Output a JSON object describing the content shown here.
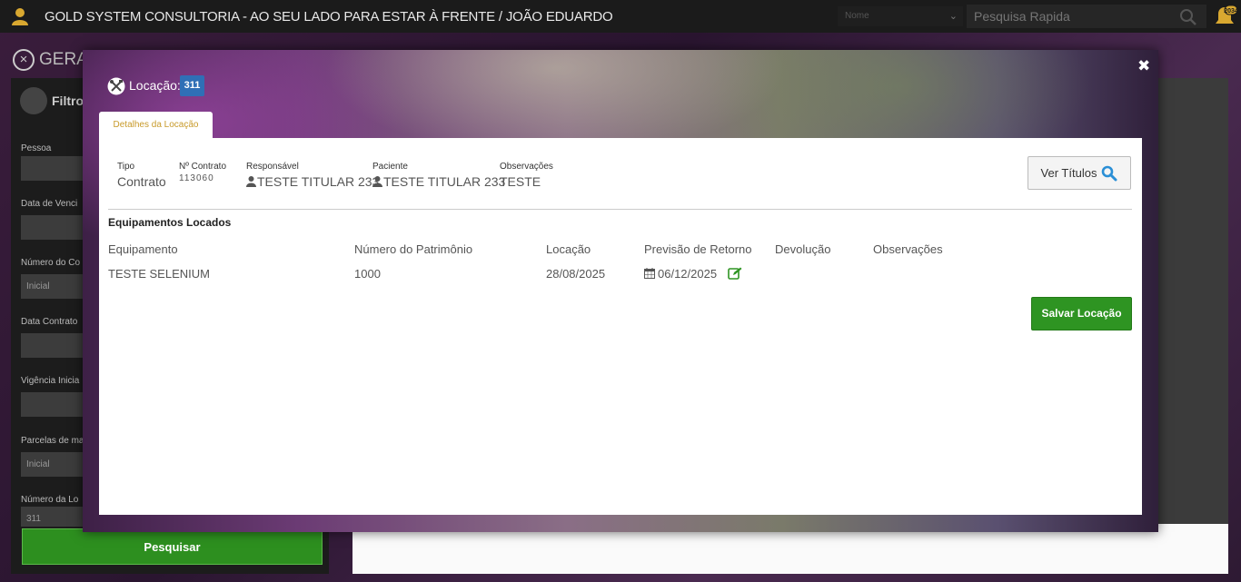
{
  "topbar": {
    "title": "GOLD SYSTEM CONSULTORIA - AO SEU LADO PARA ESTAR À FRENTE / JOÃO EDUARDO",
    "name_select": "Nome",
    "search_placeholder": "Pesquisa Rapida",
    "notification_count": "2034"
  },
  "background": {
    "page_title": "GERA",
    "filters_label": "Filtros",
    "fields": [
      {
        "label": "Pessoa",
        "value": ""
      },
      {
        "label": "Data de Venci",
        "value": ""
      },
      {
        "label": "Número do Co",
        "value": "Inicial"
      },
      {
        "label": "Data Contrato",
        "value": ""
      },
      {
        "label": "Vigência Inicia",
        "value": ""
      },
      {
        "label": "Parcelas de ma",
        "value": "Inicial"
      },
      {
        "label": "Número da Lo",
        "value": "311"
      }
    ],
    "search_button": "Pesquisar"
  },
  "modal": {
    "title_label": "Locação:",
    "location_number": "311",
    "tab_label": "Detalhes da Locação",
    "info": {
      "tipo_label": "Tipo",
      "tipo_value": "Contrato",
      "contrato_label": "Nº Contrato",
      "contrato_value": "113060",
      "responsavel_label": "Responsável",
      "responsavel_value": "TESTE TITULAR 233",
      "paciente_label": "Paciente",
      "paciente_value": "TESTE TITULAR 233",
      "observacoes_label": "Observações",
      "observacoes_value": "TESTE"
    },
    "ver_titulos_button": "Ver Títulos",
    "section_title": "Equipamentos Locados",
    "table": {
      "headers": [
        "Equipamento",
        "Número do Patrimônio",
        "Locação",
        "Previsão de Retorno",
        "Devolução",
        "Observações"
      ],
      "rows": [
        {
          "equipamento": "TESTE SELENIUM",
          "patrimonio": "1000",
          "locacao": "28/08/2025",
          "previsao": "06/12/2025",
          "devolucao": "",
          "observacoes": ""
        }
      ]
    },
    "save_button": "Salvar Locação"
  },
  "colors": {
    "accent_green": "#2e9422",
    "badge_blue": "#2f6fb6",
    "tab_text": "#c89a2a"
  }
}
